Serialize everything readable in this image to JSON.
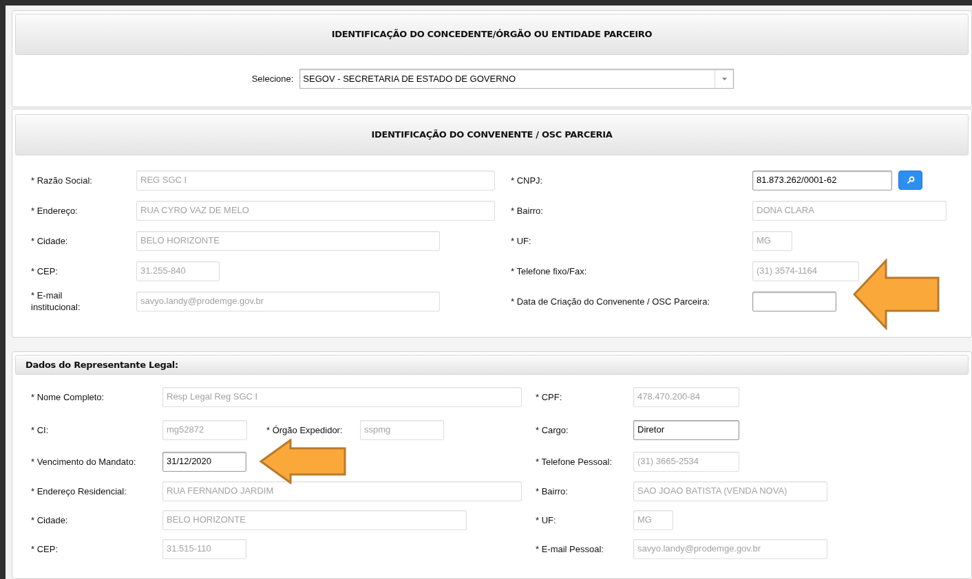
{
  "sections": [
    {
      "kind": "select",
      "title": "IDENTIFICAÇÃO DO CONCEDENTE/ÓRGÃO OU ENTIDADE PARCEIRO",
      "select": {
        "label": "Selecione:",
        "value": "SEGOV - SECRETARIA DE ESTADO DE GOVERNO"
      }
    },
    {
      "kind": "form",
      "title": "IDENTIFICAÇÃO DO CONVENENTE / OSC PARCERIA",
      "rows": [
        {
          "left": [
            {
              "label": "* Razão Social:",
              "value": "REG SGC I",
              "disabled": true
            }
          ],
          "right": [
            {
              "label": "* CNPJ:",
              "value": "81.873.262/0001-62",
              "disabled": false,
              "search_button": true
            }
          ]
        },
        {
          "left": [
            {
              "label": "* Endereço:",
              "value": "RUA  CYRO VAZ DE MELO",
              "disabled": true
            }
          ],
          "right": [
            {
              "label": "* Bairro:",
              "value": "DONA CLARA",
              "disabled": true
            }
          ]
        },
        {
          "left": [
            {
              "label": "* Cidade:",
              "value": "BELO HORIZONTE",
              "disabled": true
            }
          ],
          "right": [
            {
              "label": "* UF:",
              "value": "MG",
              "disabled": true
            }
          ]
        },
        {
          "left": [
            {
              "label": "* CEP:",
              "value": "31.255-840",
              "disabled": true
            }
          ],
          "right": [
            {
              "label": "* Telefone fixo/Fax:",
              "value": "(31) 3574-1164",
              "disabled": true
            }
          ]
        },
        {
          "left": [
            {
              "label": "* E-mail institucional:",
              "value": "savyo.landy@prodemge.gov.br",
              "disabled": true
            }
          ],
          "right": [
            {
              "label": "* Data de Criação do Convenente / OSC Parceira:",
              "disabled": false
            }
          ]
        }
      ]
    },
    {
      "kind": "subform",
      "title": "Dados do Representante Legal:",
      "rows": [
        {
          "left": [
            {
              "label": "* Nome Completo:",
              "value": "Resp Legal Reg SGC I",
              "disabled": true
            }
          ],
          "right": [
            {
              "label": "* CPF:",
              "value": "478.470.200-84",
              "disabled": true
            }
          ]
        },
        {
          "left": [
            {
              "label": "* CI:",
              "value": "mg52872",
              "disabled": true
            },
            {
              "label": "* Órgão Expedidor:",
              "value": "sspmg",
              "disabled": true
            }
          ],
          "right": [
            {
              "label": "* Cargo:",
              "value": "Diretor",
              "disabled": false
            }
          ]
        },
        {
          "left": [
            {
              "label": "* Vencimento do Mandato:",
              "value": "31/12/2020",
              "disabled": false
            }
          ],
          "right": [
            {
              "label": "* Telefone Pessoal:",
              "value": "(31) 3665-2534",
              "disabled": true
            }
          ]
        },
        {
          "left": [
            {
              "label": "* Endereço Residencial:",
              "value": "RUA  FERNANDO JARDIM",
              "disabled": true
            }
          ],
          "right": [
            {
              "label": "* Bairro:",
              "value": "SAO JOAO BATISTA (VENDA NOVA)",
              "disabled": true
            }
          ]
        },
        {
          "left": [
            {
              "label": "* Cidade:",
              "value": "BELO HORIZONTE",
              "disabled": true
            }
          ],
          "right": [
            {
              "label": "* UF:",
              "value": "MG",
              "disabled": true
            }
          ]
        },
        {
          "left": [
            {
              "label": "* CEP:",
              "value": "31.515-110",
              "disabled": true
            }
          ],
          "right": [
            {
              "label": "* E-mail Pessoal:",
              "value": "savyo.landy@prodemge.gov.br",
              "disabled": true
            }
          ]
        }
      ]
    }
  ]
}
